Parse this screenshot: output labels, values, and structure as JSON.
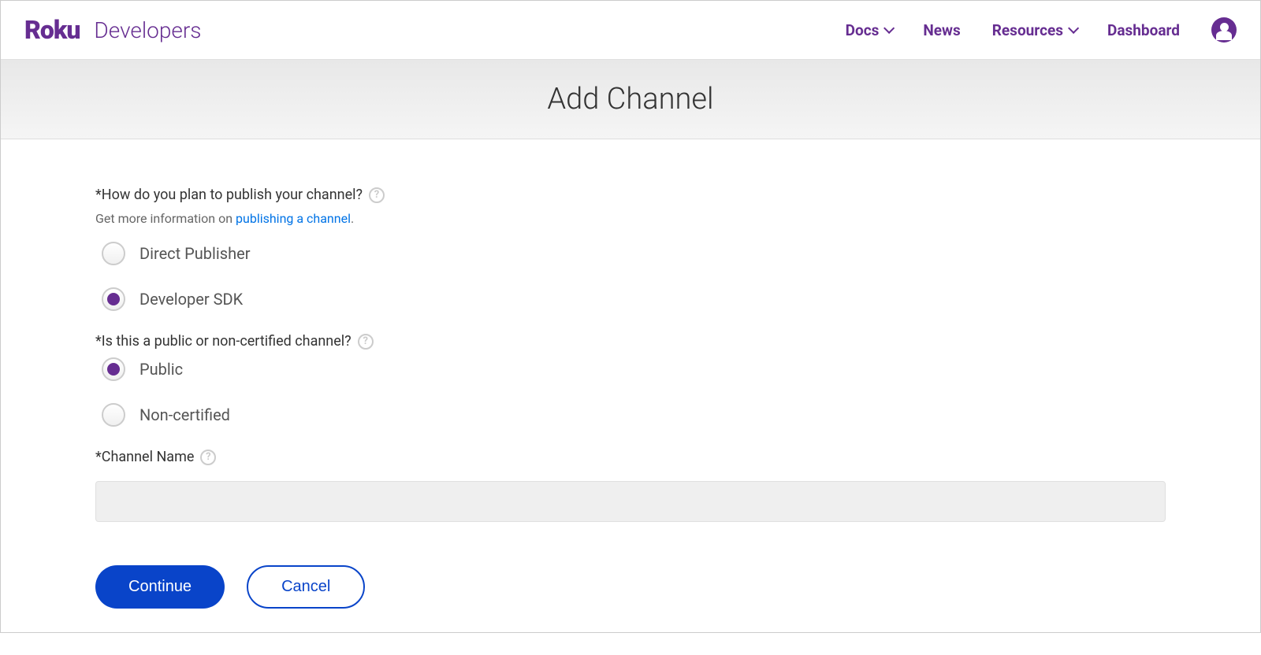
{
  "header": {
    "logo": "Roku",
    "dev_label": "Developers",
    "nav": {
      "docs": "Docs",
      "news": "News",
      "resources": "Resources",
      "dashboard": "Dashboard"
    }
  },
  "page_title": "Add Channel",
  "form": {
    "publish_question": "*How do you plan to publish your channel?",
    "publish_help_prefix": "Get more information on ",
    "publish_help_link": "publishing a channel",
    "publish_help_suffix": ".",
    "publish_options": {
      "direct_publisher": "Direct Publisher",
      "developer_sdk": "Developer SDK"
    },
    "public_question": "*Is this a public or non-certified channel?",
    "public_options": {
      "public": "Public",
      "non_certified": "Non-certified"
    },
    "channel_name_label": "*Channel Name",
    "channel_name_value": ""
  },
  "buttons": {
    "continue": "Continue",
    "cancel": "Cancel"
  }
}
